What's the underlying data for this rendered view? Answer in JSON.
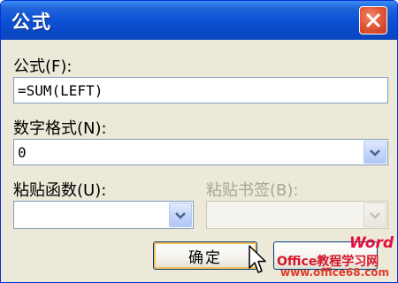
{
  "window": {
    "title": "公式"
  },
  "formula": {
    "label": "公式(F):",
    "value": "=SUM(LEFT)"
  },
  "number_format": {
    "label": "数字格式(N):",
    "value": "0"
  },
  "paste_function": {
    "label": "粘贴函数(U):",
    "value": ""
  },
  "paste_bookmark": {
    "label": "粘贴书签(B):",
    "value": "",
    "disabled": true
  },
  "buttons": {
    "ok": "确定",
    "cancel": ""
  },
  "watermark": {
    "word": "Word",
    "brand": "Office教程学习网",
    "url": "www.office68.com"
  },
  "icons": {
    "close": "close-icon",
    "dropdown": "chevron-down-icon",
    "cursor": "mouse-pointer-icon"
  },
  "colors": {
    "titlebar": "#0a48c6",
    "dialog_bg": "#ece9d8",
    "close": "#e35b3a",
    "field_border": "#7f9db9",
    "watermark": "#d4162a"
  }
}
